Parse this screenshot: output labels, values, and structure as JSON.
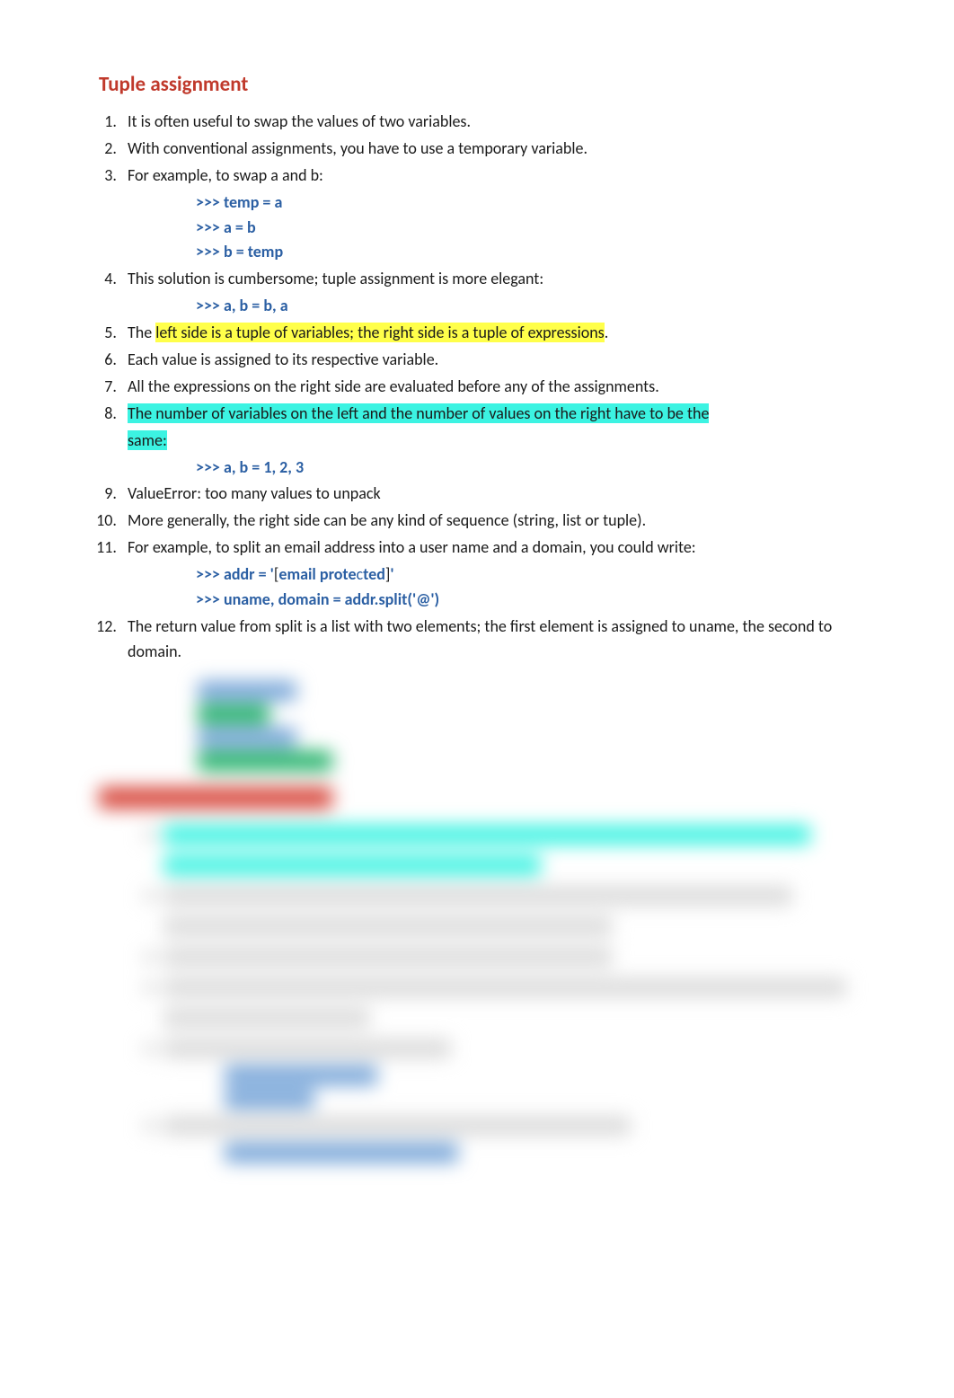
{
  "title": "Tuple assignment",
  "items": {
    "i1": "It is often useful to swap the values of two variables.",
    "i2": "With conventional assignments, you have to use a temporary variable.",
    "i3": "For example, to swap a and b:",
    "i4": "This solution is cumbersome; tuple assignment is more elegant:",
    "i5_pre": "The ",
    "i5_hl": "left side is a tuple of variables; the right side is a tuple of expressions",
    "i5_post": ".",
    "i6": "Each value is assigned to its respective variable.",
    "i7": "All the expressions on the right side are evaluated before any of the assignments.",
    "i8a": "The number of variables on the left and the number of values on the right have to be the",
    "i8b": "same:",
    "i9": "ValueError: too many values to unpack",
    "i10": "More generally, the right side can be any kind of sequence (string, list or tuple).",
    "i11": "For example, to split an email address into a user name and a domain, you could write:",
    "i12": "The return value from split is a list with two elements; the first element is assigned to uname, the second to domain."
  },
  "code": {
    "swap1": ">>> temp = a",
    "swap2": ">>> a = b",
    "swap3": ">>> b = temp",
    "tup1": ">>> a, b = b, a",
    "err1": ">>> a, b = 1, 2, 3",
    "addr_pre": ">>> addr = '",
    "addr_lb": "[",
    "addr_em": "email prote",
    "addr_c": "c",
    "addr_ted": "ted",
    "addr_rb": "]",
    "addr_post": "'",
    "split": ">>> uname, domain = addr.split('@')"
  }
}
